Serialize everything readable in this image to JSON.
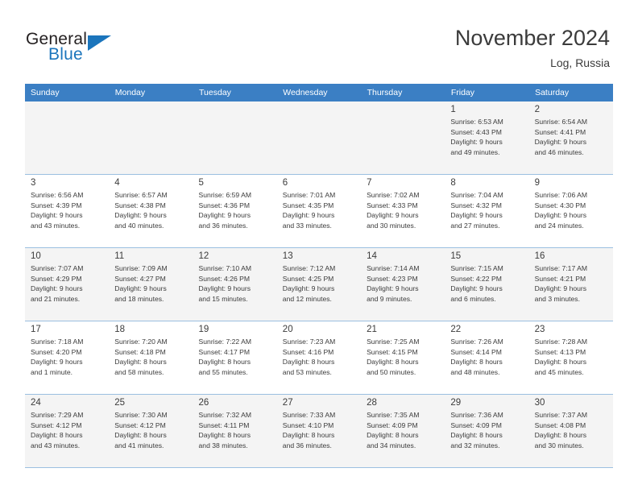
{
  "brand": {
    "word1": "General",
    "word2": "Blue",
    "triangle_color": "#1b75bc",
    "text_color": "#231f20"
  },
  "header": {
    "title": "November 2024",
    "subtitle": "Log, Russia",
    "header_bg": "#3b7fc4",
    "header_text": "#ffffff",
    "row_alt_bg": "#f4f4f4",
    "grid_line": "#9bbfe0"
  },
  "weekday_headers": [
    "Sunday",
    "Monday",
    "Tuesday",
    "Wednesday",
    "Thursday",
    "Friday",
    "Saturday"
  ],
  "labels": {
    "sunrise": "Sunrise:",
    "sunset": "Sunset:",
    "daylight": "Daylight:"
  },
  "weeks": [
    [
      {
        "day": "",
        "sunrise": "",
        "sunset": "",
        "daylight_l1": "",
        "daylight_l2": "",
        "empty": true
      },
      {
        "day": "",
        "sunrise": "",
        "sunset": "",
        "daylight_l1": "",
        "daylight_l2": "",
        "empty": true
      },
      {
        "day": "",
        "sunrise": "",
        "sunset": "",
        "daylight_l1": "",
        "daylight_l2": "",
        "empty": true
      },
      {
        "day": "",
        "sunrise": "",
        "sunset": "",
        "daylight_l1": "",
        "daylight_l2": "",
        "empty": true
      },
      {
        "day": "",
        "sunrise": "",
        "sunset": "",
        "daylight_l1": "",
        "daylight_l2": "",
        "empty": true
      },
      {
        "day": "1",
        "sunrise": "Sunrise: 6:53 AM",
        "sunset": "Sunset: 4:43 PM",
        "daylight_l1": "Daylight: 9 hours",
        "daylight_l2": "and 49 minutes.",
        "empty": false
      },
      {
        "day": "2",
        "sunrise": "Sunrise: 6:54 AM",
        "sunset": "Sunset: 4:41 PM",
        "daylight_l1": "Daylight: 9 hours",
        "daylight_l2": "and 46 minutes.",
        "empty": false
      }
    ],
    [
      {
        "day": "3",
        "sunrise": "Sunrise: 6:56 AM",
        "sunset": "Sunset: 4:39 PM",
        "daylight_l1": "Daylight: 9 hours",
        "daylight_l2": "and 43 minutes.",
        "empty": false
      },
      {
        "day": "4",
        "sunrise": "Sunrise: 6:57 AM",
        "sunset": "Sunset: 4:38 PM",
        "daylight_l1": "Daylight: 9 hours",
        "daylight_l2": "and 40 minutes.",
        "empty": false
      },
      {
        "day": "5",
        "sunrise": "Sunrise: 6:59 AM",
        "sunset": "Sunset: 4:36 PM",
        "daylight_l1": "Daylight: 9 hours",
        "daylight_l2": "and 36 minutes.",
        "empty": false
      },
      {
        "day": "6",
        "sunrise": "Sunrise: 7:01 AM",
        "sunset": "Sunset: 4:35 PM",
        "daylight_l1": "Daylight: 9 hours",
        "daylight_l2": "and 33 minutes.",
        "empty": false
      },
      {
        "day": "7",
        "sunrise": "Sunrise: 7:02 AM",
        "sunset": "Sunset: 4:33 PM",
        "daylight_l1": "Daylight: 9 hours",
        "daylight_l2": "and 30 minutes.",
        "empty": false
      },
      {
        "day": "8",
        "sunrise": "Sunrise: 7:04 AM",
        "sunset": "Sunset: 4:32 PM",
        "daylight_l1": "Daylight: 9 hours",
        "daylight_l2": "and 27 minutes.",
        "empty": false
      },
      {
        "day": "9",
        "sunrise": "Sunrise: 7:06 AM",
        "sunset": "Sunset: 4:30 PM",
        "daylight_l1": "Daylight: 9 hours",
        "daylight_l2": "and 24 minutes.",
        "empty": false
      }
    ],
    [
      {
        "day": "10",
        "sunrise": "Sunrise: 7:07 AM",
        "sunset": "Sunset: 4:29 PM",
        "daylight_l1": "Daylight: 9 hours",
        "daylight_l2": "and 21 minutes.",
        "empty": false
      },
      {
        "day": "11",
        "sunrise": "Sunrise: 7:09 AM",
        "sunset": "Sunset: 4:27 PM",
        "daylight_l1": "Daylight: 9 hours",
        "daylight_l2": "and 18 minutes.",
        "empty": false
      },
      {
        "day": "12",
        "sunrise": "Sunrise: 7:10 AM",
        "sunset": "Sunset: 4:26 PM",
        "daylight_l1": "Daylight: 9 hours",
        "daylight_l2": "and 15 minutes.",
        "empty": false
      },
      {
        "day": "13",
        "sunrise": "Sunrise: 7:12 AM",
        "sunset": "Sunset: 4:25 PM",
        "daylight_l1": "Daylight: 9 hours",
        "daylight_l2": "and 12 minutes.",
        "empty": false
      },
      {
        "day": "14",
        "sunrise": "Sunrise: 7:14 AM",
        "sunset": "Sunset: 4:23 PM",
        "daylight_l1": "Daylight: 9 hours",
        "daylight_l2": "and 9 minutes.",
        "empty": false
      },
      {
        "day": "15",
        "sunrise": "Sunrise: 7:15 AM",
        "sunset": "Sunset: 4:22 PM",
        "daylight_l1": "Daylight: 9 hours",
        "daylight_l2": "and 6 minutes.",
        "empty": false
      },
      {
        "day": "16",
        "sunrise": "Sunrise: 7:17 AM",
        "sunset": "Sunset: 4:21 PM",
        "daylight_l1": "Daylight: 9 hours",
        "daylight_l2": "and 3 minutes.",
        "empty": false
      }
    ],
    [
      {
        "day": "17",
        "sunrise": "Sunrise: 7:18 AM",
        "sunset": "Sunset: 4:20 PM",
        "daylight_l1": "Daylight: 9 hours",
        "daylight_l2": "and 1 minute.",
        "empty": false
      },
      {
        "day": "18",
        "sunrise": "Sunrise: 7:20 AM",
        "sunset": "Sunset: 4:18 PM",
        "daylight_l1": "Daylight: 8 hours",
        "daylight_l2": "and 58 minutes.",
        "empty": false
      },
      {
        "day": "19",
        "sunrise": "Sunrise: 7:22 AM",
        "sunset": "Sunset: 4:17 PM",
        "daylight_l1": "Daylight: 8 hours",
        "daylight_l2": "and 55 minutes.",
        "empty": false
      },
      {
        "day": "20",
        "sunrise": "Sunrise: 7:23 AM",
        "sunset": "Sunset: 4:16 PM",
        "daylight_l1": "Daylight: 8 hours",
        "daylight_l2": "and 53 minutes.",
        "empty": false
      },
      {
        "day": "21",
        "sunrise": "Sunrise: 7:25 AM",
        "sunset": "Sunset: 4:15 PM",
        "daylight_l1": "Daylight: 8 hours",
        "daylight_l2": "and 50 minutes.",
        "empty": false
      },
      {
        "day": "22",
        "sunrise": "Sunrise: 7:26 AM",
        "sunset": "Sunset: 4:14 PM",
        "daylight_l1": "Daylight: 8 hours",
        "daylight_l2": "and 48 minutes.",
        "empty": false
      },
      {
        "day": "23",
        "sunrise": "Sunrise: 7:28 AM",
        "sunset": "Sunset: 4:13 PM",
        "daylight_l1": "Daylight: 8 hours",
        "daylight_l2": "and 45 minutes.",
        "empty": false
      }
    ],
    [
      {
        "day": "24",
        "sunrise": "Sunrise: 7:29 AM",
        "sunset": "Sunset: 4:12 PM",
        "daylight_l1": "Daylight: 8 hours",
        "daylight_l2": "and 43 minutes.",
        "empty": false
      },
      {
        "day": "25",
        "sunrise": "Sunrise: 7:30 AM",
        "sunset": "Sunset: 4:12 PM",
        "daylight_l1": "Daylight: 8 hours",
        "daylight_l2": "and 41 minutes.",
        "empty": false
      },
      {
        "day": "26",
        "sunrise": "Sunrise: 7:32 AM",
        "sunset": "Sunset: 4:11 PM",
        "daylight_l1": "Daylight: 8 hours",
        "daylight_l2": "and 38 minutes.",
        "empty": false
      },
      {
        "day": "27",
        "sunrise": "Sunrise: 7:33 AM",
        "sunset": "Sunset: 4:10 PM",
        "daylight_l1": "Daylight: 8 hours",
        "daylight_l2": "and 36 minutes.",
        "empty": false
      },
      {
        "day": "28",
        "sunrise": "Sunrise: 7:35 AM",
        "sunset": "Sunset: 4:09 PM",
        "daylight_l1": "Daylight: 8 hours",
        "daylight_l2": "and 34 minutes.",
        "empty": false
      },
      {
        "day": "29",
        "sunrise": "Sunrise: 7:36 AM",
        "sunset": "Sunset: 4:09 PM",
        "daylight_l1": "Daylight: 8 hours",
        "daylight_l2": "and 32 minutes.",
        "empty": false
      },
      {
        "day": "30",
        "sunrise": "Sunrise: 7:37 AM",
        "sunset": "Sunset: 4:08 PM",
        "daylight_l1": "Daylight: 8 hours",
        "daylight_l2": "and 30 minutes.",
        "empty": false
      }
    ]
  ]
}
